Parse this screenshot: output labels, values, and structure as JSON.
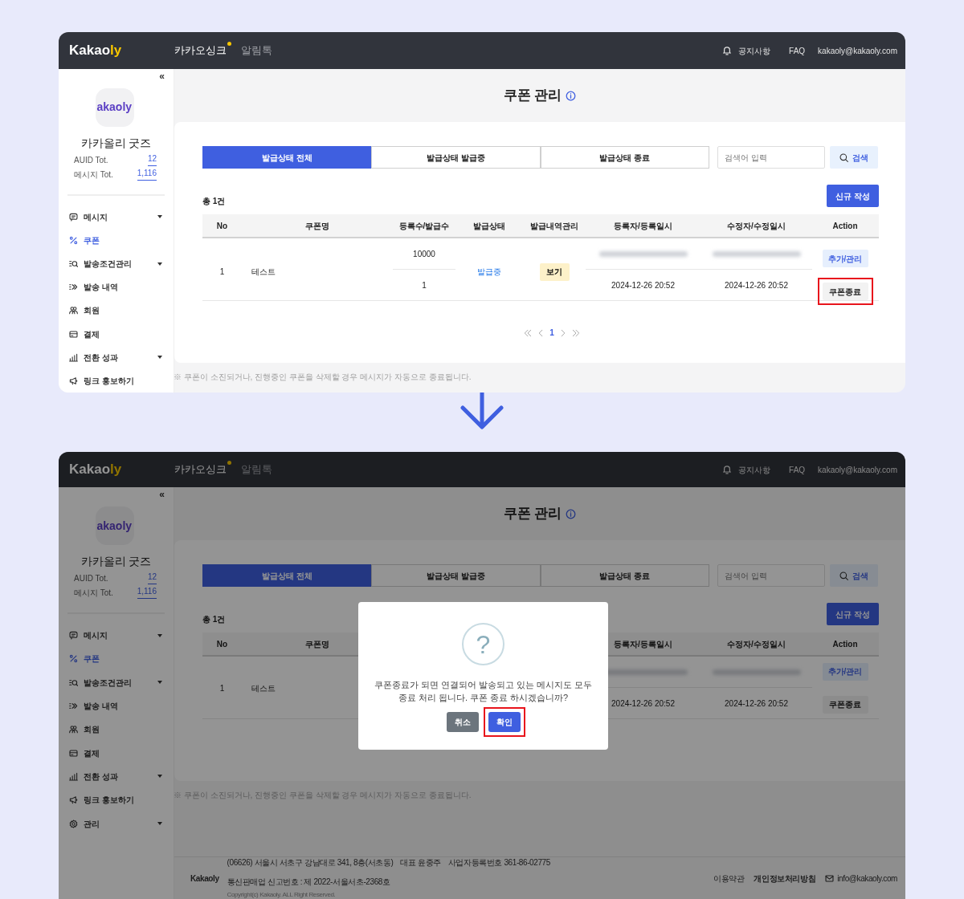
{
  "screens": [
    {
      "header": {
        "logo": "Kakao",
        "logo_suffix": "ly",
        "nav": [
          {
            "label": "카카오싱크",
            "selected": true,
            "dot": true
          },
          {
            "label": "알림톡",
            "selected": false,
            "dot": false
          }
        ],
        "notice": "공지사항",
        "faq": "FAQ",
        "account": "kakaoly@kakaoly.com"
      },
      "sidebar": {
        "collapse": "«",
        "brand_logo": "akaoly",
        "name": "카카올리 굿즈",
        "stats": [
          {
            "label": "AUID Tot.",
            "value": "12"
          },
          {
            "label": "메시지 Tot.",
            "value": "1,116"
          }
        ],
        "menu": [
          {
            "label": "메시지",
            "caret": true,
            "selected": false
          },
          {
            "label": "쿠폰",
            "caret": false,
            "selected": true
          },
          {
            "label": "발송조건관리",
            "caret": true,
            "selected": false
          },
          {
            "label": "발송 내역",
            "caret": false,
            "selected": false
          },
          {
            "label": "회원",
            "caret": false,
            "selected": false
          },
          {
            "label": "결제",
            "caret": false,
            "selected": false
          },
          {
            "label": "전환 성과",
            "caret": true,
            "selected": false
          },
          {
            "label": "링크 홍보하기",
            "caret": false,
            "selected": false
          }
        ]
      },
      "content": {
        "title": "쿠폰 관리",
        "tabs": [
          {
            "label": "발급상태 전체",
            "selected": true
          },
          {
            "label": "발급상태 발급중",
            "selected": false
          },
          {
            "label": "발급상태 종료",
            "selected": false
          }
        ],
        "search": {
          "placeholder": "검색어 입력",
          "button": "검색"
        },
        "total": "총 1건",
        "new_button": "신규 작성",
        "columns": [
          {
            "kind": "no",
            "label": "No"
          },
          {
            "kind": "name",
            "label": "쿠폰명"
          },
          {
            "kind": "counts",
            "label": "등록수/발급수"
          },
          {
            "kind": "status",
            "label": "발급상태"
          },
          {
            "kind": "history",
            "label": "발급내역관리"
          },
          {
            "kind": "registered",
            "label": "등록자/등록일시"
          },
          {
            "kind": "modified",
            "label": "수정자/수정일시"
          },
          {
            "kind": "actions",
            "label": "Action"
          }
        ],
        "rows": [
          {
            "no": "1",
            "name": "테스트",
            "counts": [
              "10000",
              "1"
            ],
            "status": "발급중",
            "history_button": "보기",
            "registered": "2024-12-26 20:52",
            "modified": "2024-12-26 20:52",
            "actions": [
              {
                "label": "추가/관리",
                "kind": "manage",
                "highlighted": false
              },
              {
                "label": "쿠폰종료",
                "kind": "end",
                "highlighted": true
              }
            ]
          }
        ],
        "pagination": {
          "pages": [
            {
              "label": "1",
              "selected": true
            }
          ]
        },
        "note": "※ 쿠폰이 소진되거나, 진행중인 쿠폰을 삭제할 경우 메시지가 자동으로 종료됩니다."
      }
    },
    {
      "header": {
        "logo": "Kakao",
        "logo_suffix": "ly",
        "nav": [
          {
            "label": "카카오싱크",
            "selected": true,
            "dot": true
          },
          {
            "label": "알림톡",
            "selected": false,
            "dot": false
          }
        ],
        "notice": "공지사항",
        "faq": "FAQ",
        "account": "kakaoly@kakaoly.com"
      },
      "sidebar": {
        "collapse": "«",
        "brand_logo": "akaoly",
        "name": "카카올리 굿즈",
        "stats": [
          {
            "label": "AUID Tot.",
            "value": "12"
          },
          {
            "label": "메시지 Tot.",
            "value": "1,116"
          }
        ],
        "menu": [
          {
            "label": "메시지",
            "caret": true,
            "selected": false
          },
          {
            "label": "쿠폰",
            "caret": false,
            "selected": true
          },
          {
            "label": "발송조건관리",
            "caret": true,
            "selected": false
          },
          {
            "label": "발송 내역",
            "caret": false,
            "selected": false
          },
          {
            "label": "회원",
            "caret": false,
            "selected": false
          },
          {
            "label": "결제",
            "caret": false,
            "selected": false
          },
          {
            "label": "전환 성과",
            "caret": true,
            "selected": false
          },
          {
            "label": "링크 홍보하기",
            "caret": false,
            "selected": false
          },
          {
            "label": "관리",
            "caret": true,
            "selected": false
          }
        ]
      },
      "content": {
        "title": "쿠폰 관리",
        "tabs": [
          {
            "label": "발급상태 전체",
            "selected": true
          },
          {
            "label": "발급상태 발급중",
            "selected": false
          },
          {
            "label": "발급상태 종료",
            "selected": false
          }
        ],
        "search": {
          "placeholder": "검색어 입력",
          "button": "검색"
        },
        "total": "총 1건",
        "new_button": "신규 작성",
        "columns": [
          {
            "kind": "no",
            "label": "No"
          },
          {
            "kind": "name",
            "label": "쿠폰명"
          },
          {
            "kind": "registered",
            "label": "등록자/등록일시"
          },
          {
            "kind": "modified",
            "label": "수정자/수정일시"
          },
          {
            "kind": "actions",
            "label": "Action"
          }
        ],
        "rows": [
          {
            "no": "1",
            "name": "테스트",
            "registered": "2024-12-26 20:52",
            "modified": "2024-12-26 20:52",
            "actions": [
              {
                "label": "추가/관리",
                "kind": "manage",
                "highlighted": false
              },
              {
                "label": "쿠폰종료",
                "kind": "end",
                "highlighted": false
              }
            ]
          }
        ],
        "note": "※ 쿠폰이 소진되거나, 진행중인 쿠폰을 삭제할 경우 메시지가 자동으로 종료됩니다."
      },
      "modal": {
        "icon_text": "?",
        "message": "쿠폰종료가 되면 연결되어 발송되고 있는 메시지도 모두 종료 처리 됩니다. 쿠폰 종료 하시겠습니까?",
        "buttons": [
          {
            "label": "취소",
            "kind": "cancel",
            "highlighted": false
          },
          {
            "label": "확인",
            "kind": "confirm",
            "highlighted": true
          }
        ]
      },
      "footer": {
        "brand": "Kakaoly",
        "items": [
          "(06626) 서울시 서초구 강남대로 341, 8층(서초동)",
          "대표 윤중주",
          "사업자등록번호 361-86-02775",
          "통신판매업 신고번호 : 제 2022-서울서초-2368호"
        ],
        "copyright": "Copyright(c) Kakaoly. ALL Right Reserved.",
        "links": [
          {
            "label": "이용약관",
            "bold": false
          },
          {
            "label": "개인정보처리방침",
            "bold": true
          }
        ],
        "email": "info@kakaoly.com"
      }
    }
  ]
}
